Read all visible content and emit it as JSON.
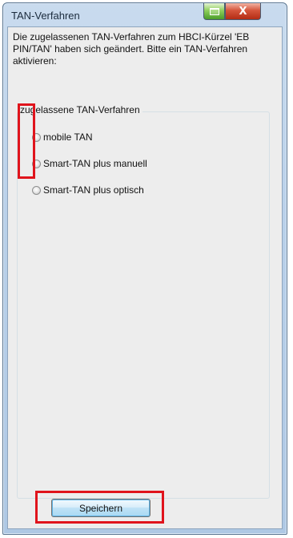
{
  "window": {
    "title": "TAN-Verfahren",
    "close_label": "X"
  },
  "intro_text": "Die zugelassenen TAN-Verfahren zum HBCI-Kürzel 'EB PIN/TAN' haben sich geändert. Bitte ein TAN-Verfahren aktivieren:",
  "group": {
    "label": "zugelassene TAN-Verfahren",
    "options": [
      {
        "label": "mobile TAN",
        "selected": false
      },
      {
        "label": "Smart-TAN plus manuell",
        "selected": false
      },
      {
        "label": "Smart-TAN plus optisch",
        "selected": false
      }
    ]
  },
  "save_label": "Speichern",
  "colors": {
    "highlight": "#e0141c",
    "titlebar": "#b9d0e9",
    "client_bg": "#ededed"
  },
  "icons": {
    "minimize": "minimize-icon",
    "close": "close-icon"
  }
}
